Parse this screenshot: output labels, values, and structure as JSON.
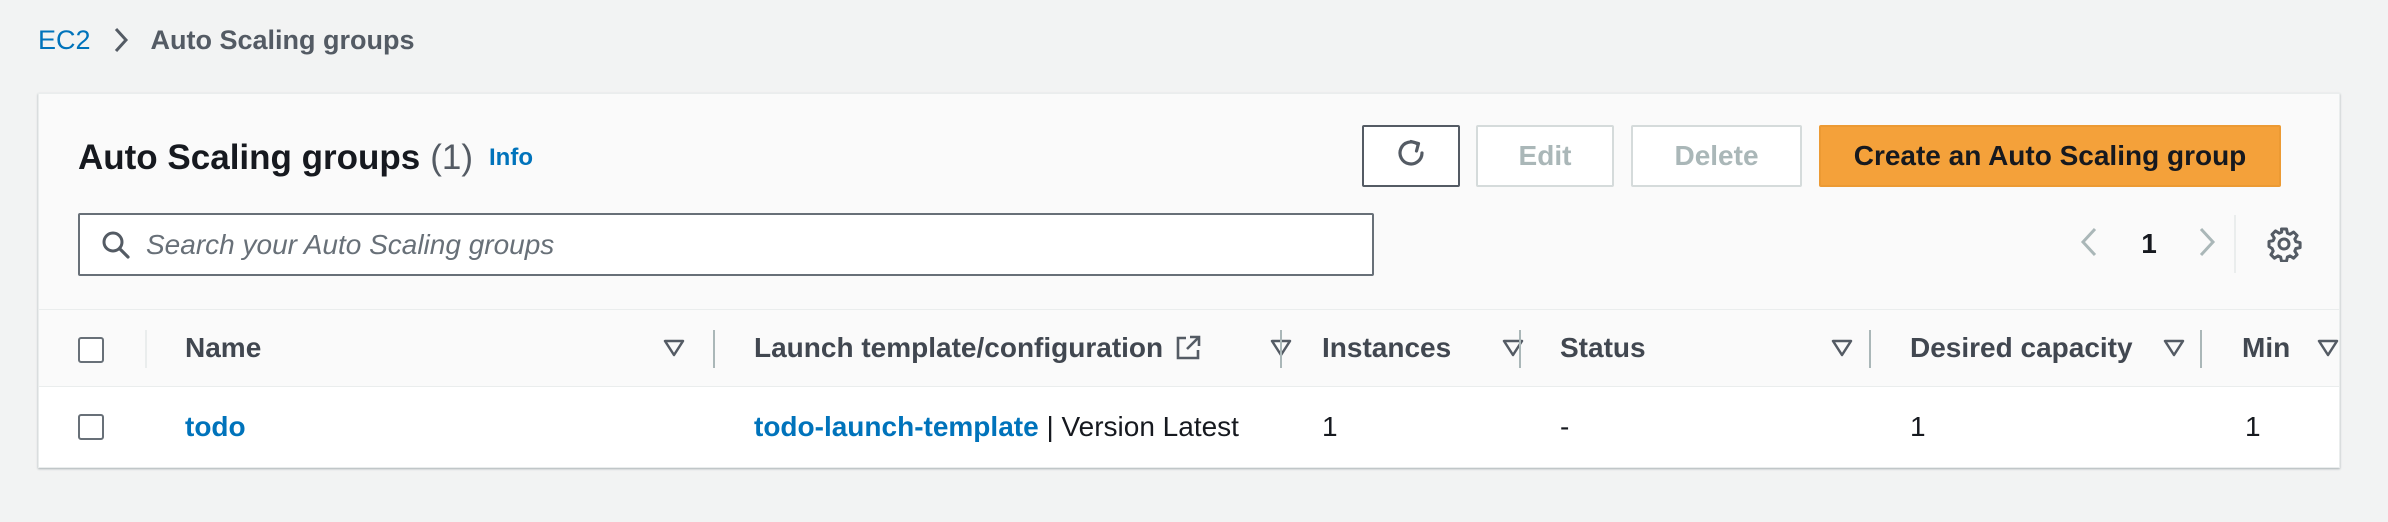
{
  "breadcrumb": {
    "root": "EC2",
    "current": "Auto Scaling groups"
  },
  "panel": {
    "title": "Auto Scaling groups",
    "count": "(1)",
    "info": "Info"
  },
  "actions": {
    "edit": "Edit",
    "delete": "Delete",
    "create": "Create an Auto Scaling group"
  },
  "search": {
    "placeholder": "Search your Auto Scaling groups",
    "value": ""
  },
  "pagination": {
    "page": "1"
  },
  "table": {
    "columns": {
      "name": "Name",
      "launch_template": "Launch template/configuration",
      "instances": "Instances",
      "status": "Status",
      "desired_capacity": "Desired capacity",
      "min": "Min"
    },
    "rows": [
      {
        "name": "todo",
        "launch_template_name": "todo-launch-template",
        "launch_template_version": " | Version Latest",
        "instances": "1",
        "status": "-",
        "desired_capacity": "1",
        "min": "1"
      }
    ]
  },
  "colors": {
    "link": "#0073bb",
    "primary_button": "#f4a13a",
    "background": "#f2f3f3"
  },
  "icons": [
    "chevron-right-icon",
    "refresh-icon",
    "search-icon",
    "chevron-left-icon",
    "settings-icon",
    "sort-icon",
    "external-link-icon"
  ]
}
